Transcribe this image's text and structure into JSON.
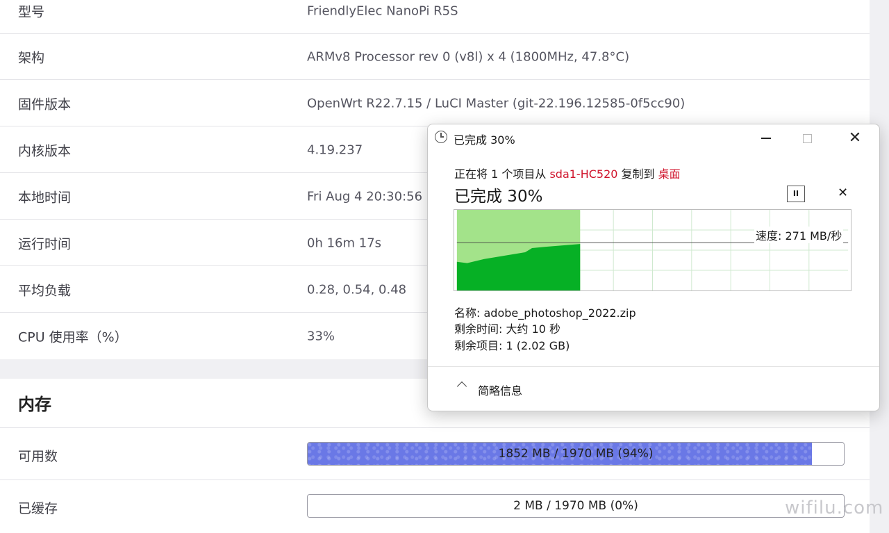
{
  "info_rows": [
    {
      "key": "型号",
      "value": "FriendlyElec NanoPi R5S"
    },
    {
      "key": "架构",
      "value": "ARMv8 Processor rev 0 (v8l) x 4 (1800MHz, 47.8°C)"
    },
    {
      "key": "固件版本",
      "value": "OpenWrt R22.7.15 / LuCI Master (git-22.196.12585-0f5cc90)"
    },
    {
      "key": "内核版本",
      "value": "4.19.237"
    },
    {
      "key": "本地时间",
      "value": "Fri Aug 4 20:30:56 2"
    },
    {
      "key": "运行时间",
      "value": "0h 16m 17s"
    },
    {
      "key": "平均负载",
      "value": "0.28, 0.54, 0.48"
    },
    {
      "key": "CPU 使用率（%）",
      "value": "33%"
    }
  ],
  "memory": {
    "title": "内存",
    "available": {
      "label": "可用数",
      "text": "1852 MB / 1970 MB (94%)",
      "fraction": 0.94
    },
    "cached": {
      "label": "已缓存",
      "text": "2 MB / 1970 MB (0%)",
      "fraction": 0.0
    }
  },
  "watermark": "wifilu.com",
  "dialog": {
    "title": "已完成 30%",
    "desc_prefix": "正在将 1 个项目从 ",
    "source": "sda1-HC520",
    "desc_middle": " 复制到 ",
    "destination": "桌面",
    "progress_text": "已完成 30%",
    "progress": 0.3,
    "pause_glyph": "II",
    "cancel_glyph": "✕",
    "close_glyph": "✕",
    "speed": "速度: 271 MB/秒",
    "name": "名称: adobe_photoshop_2022.zip",
    "time_left": "剩余时间: 大约 10 秒",
    "items_left": "剩余项目: 1 (2.02 GB)",
    "fewer_details": "简略信息",
    "colors": {
      "red": "#d0142c",
      "graph_light": "#a3e38a",
      "graph_dark": "#06b025"
    }
  }
}
